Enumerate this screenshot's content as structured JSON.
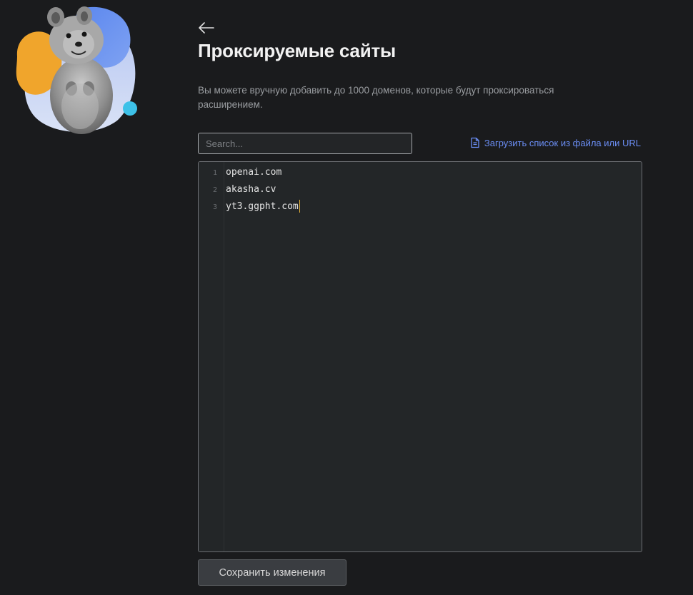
{
  "header": {
    "back_icon": "arrow-left-icon",
    "title": "Проксируемые сайты",
    "description": "Вы можете вручную добавить до 1000 доменов, которые будут проксироваться расширением."
  },
  "search": {
    "placeholder": "Search...",
    "value": ""
  },
  "load_link": {
    "icon": "file-document-icon",
    "label": "Загрузить список из файла или URL"
  },
  "editor": {
    "lines": [
      {
        "number": "1",
        "text": "openai.com"
      },
      {
        "number": "2",
        "text": "akasha.cv"
      },
      {
        "number": "3",
        "text": "yt3.ggpht.com"
      }
    ]
  },
  "save_button": {
    "label": "Сохранить изменения"
  },
  "colors": {
    "background": "#1a1b1d",
    "editor_background": "#232628",
    "link": "#6b8ef5",
    "cursor": "#e8b339",
    "mascot_orange": "#f0a52c",
    "mascot_blue": "#5f8ef0",
    "mascot_cyan": "#3dc1e8"
  }
}
